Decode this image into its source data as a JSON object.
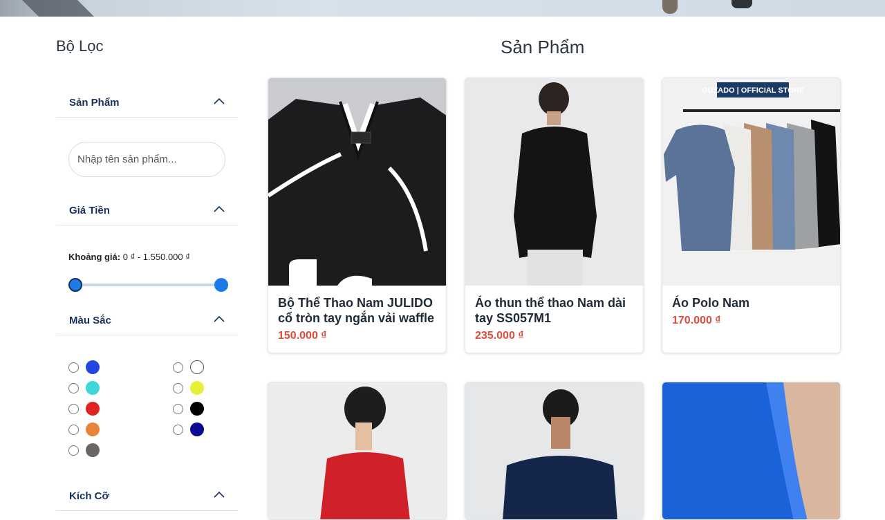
{
  "sidebar": {
    "title": "Bộ Lọc",
    "sections": {
      "product": {
        "label": "Sản Phẩm"
      },
      "price": {
        "label": "Giá Tiền"
      },
      "color": {
        "label": "Màu Sắc"
      },
      "size": {
        "label": "Kích Cỡ"
      }
    },
    "search": {
      "placeholder": "Nhập tên sản phẩm..."
    },
    "price_range": {
      "label": "Khoảng giá:",
      "value": "0 ₫ - 1.550.000 ₫",
      "min_fraction": 0,
      "max_fraction": 1
    },
    "colors": [
      "#2247e0",
      "#3ed6d6",
      "#e02424",
      "#e8843a",
      "#6b6664",
      "#ffffff",
      "#e6f03a",
      "#000000",
      "#0b0b8f"
    ]
  },
  "main": {
    "title": "Sản Phẩm",
    "products": [
      {
        "name": "Bộ Thể Thao Nam JULIDO cổ tròn tay ngắn vải waffle",
        "price": "150.000 ₫"
      },
      {
        "name": "Áo thun thể thao Nam dài tay SS057M1",
        "price": "235.000 ₫"
      },
      {
        "name": "Áo Polo Nam",
        "price": "170.000 ₫",
        "brand_badge": "GUZADO | OFFICIAL STORE"
      },
      {
        "name": "",
        "price": ""
      },
      {
        "name": "",
        "price": ""
      },
      {
        "name": "",
        "price": ""
      }
    ]
  },
  "colors": {
    "accent": "#1e7ae6",
    "heading": "#16325c",
    "price": "#e14b3b"
  }
}
